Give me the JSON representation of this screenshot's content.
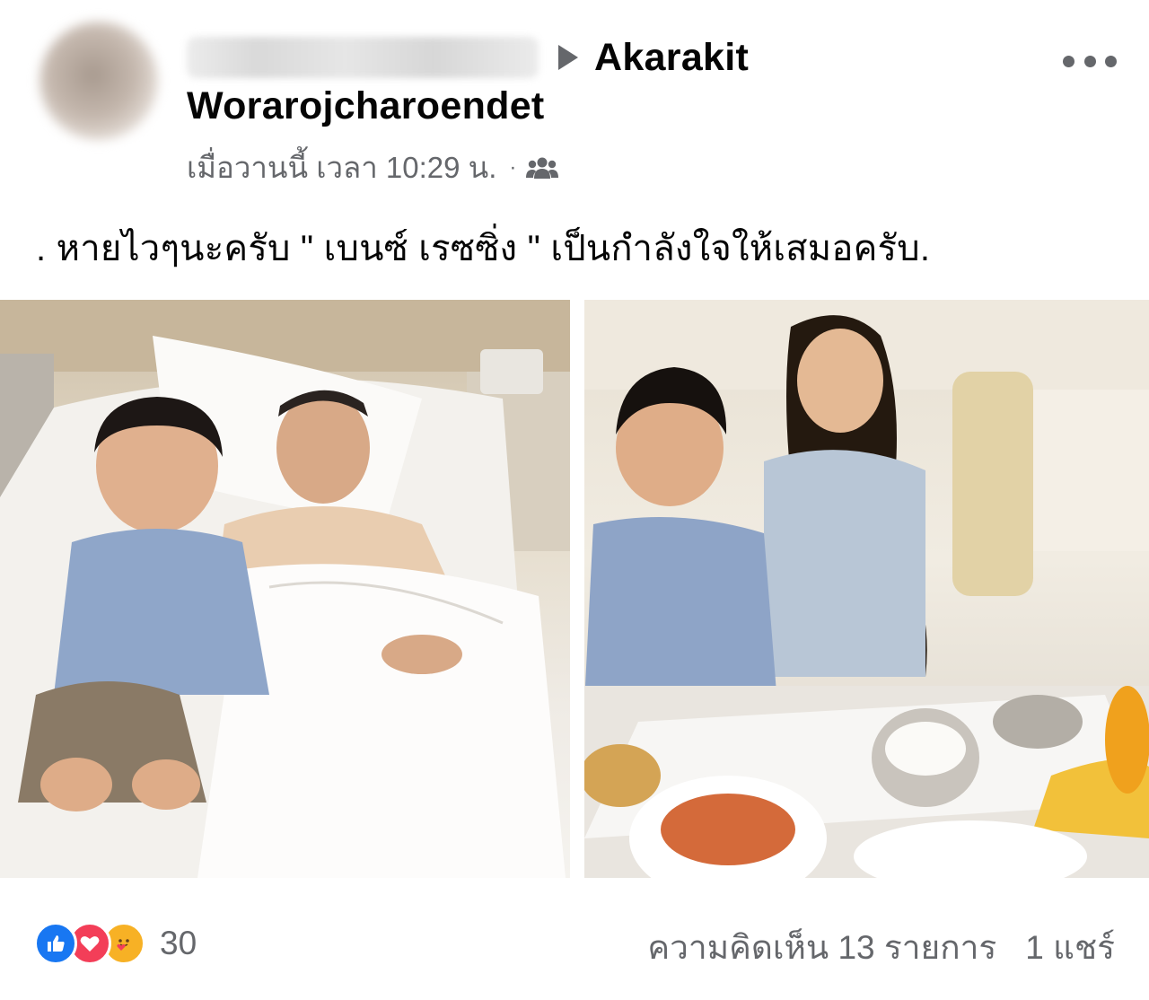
{
  "post": {
    "author_name_blurred": "Nakorn Samerma",
    "arrow_icon": "right-triangle-icon",
    "target_page_line1": "Akarakit",
    "target_page_line2": "Worarojcharoendet",
    "timestamp": "เมื่อวานนี้ เวลา 10:29 น.",
    "separator": "·",
    "audience_icon": "group-icon",
    "more_icon": "more-options-icon",
    "caption": ".  หายไวๆนะครับ \" เบนซ์ เรซซิ่ง \" เป็นกำลังใจให้เสมอครับ."
  },
  "photos": [
    {
      "icon": "photo-hospital-bed"
    },
    {
      "icon": "photo-meal-table"
    }
  ],
  "footer": {
    "reactions": [
      "like-icon",
      "love-icon",
      "care-icon"
    ],
    "reaction_count": "30",
    "comments": "ความคิดเห็น 13 รายการ",
    "shares": "1 แชร์"
  },
  "colors": {
    "secondary_text": "#65676b",
    "like_blue": "#1877f2",
    "love_red": "#f33e58",
    "care_yellow": "#f7b125"
  }
}
